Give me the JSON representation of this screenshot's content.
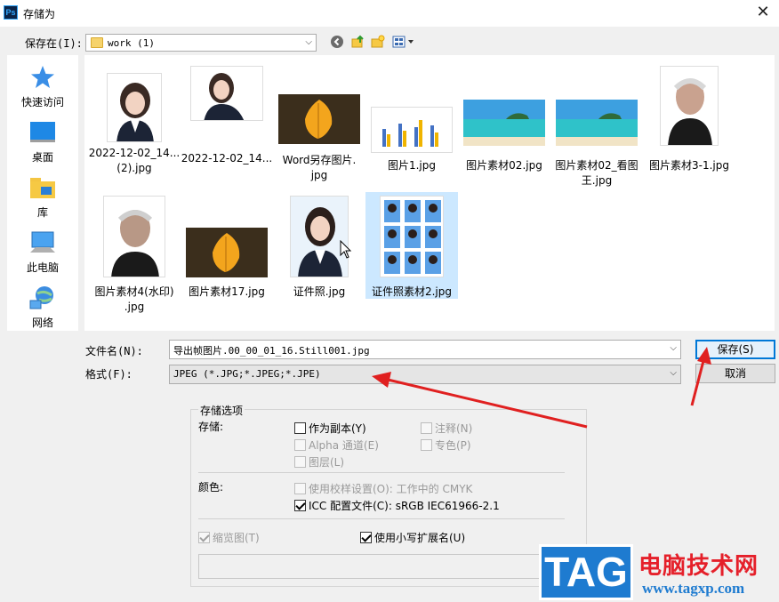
{
  "window": {
    "title": "存储为",
    "app_icon_text": "Ps"
  },
  "save_in": {
    "label": "保存在(I):",
    "folder": "work (1)"
  },
  "sidebar": {
    "items": [
      {
        "label": "快速访问",
        "icon": "star-icon"
      },
      {
        "label": "桌面",
        "icon": "desktop-icon"
      },
      {
        "label": "库",
        "icon": "library-icon"
      },
      {
        "label": "此电脑",
        "icon": "computer-icon"
      },
      {
        "label": "网络",
        "icon": "network-icon"
      }
    ]
  },
  "files": [
    {
      "name": "2022-12-02_14...(2).jpg",
      "line1": "2022-12-02_14...",
      "line2": "(2).jpg"
    },
    {
      "name": "2022-12-02_14...",
      "line1": "2022-12-02_14...",
      "line2": ""
    },
    {
      "name": "Word另存图片.jpg",
      "line1": "Word另存图片.",
      "line2": "jpg"
    },
    {
      "name": "图片1.jpg",
      "line1": "图片1.jpg",
      "line2": ""
    },
    {
      "name": "图片素材02.jpg",
      "line1": "图片素材02.jpg",
      "line2": ""
    },
    {
      "name": "图片素材02_看图王.jpg",
      "line1": "图片素材02_看图",
      "line2": "王.jpg"
    },
    {
      "name": "图片素材3-1.jpg",
      "line1": "图片素材3-1.jpg",
      "line2": ""
    },
    {
      "name": "图片素材4(水印).jpg",
      "line1": "图片素材4(水印)",
      "line2": ".jpg"
    },
    {
      "name": "图片素材17.jpg",
      "line1": "图片素材17.jpg",
      "line2": ""
    },
    {
      "name": "证件照.jpg",
      "line1": "证件照.jpg",
      "line2": ""
    },
    {
      "name": "证件照素材2.jpg",
      "line1": "证件照素材2.jpg",
      "line2": ""
    }
  ],
  "filename": {
    "label": "文件名(N):",
    "value": "导出帧图片.00_00_01_16.Still001.jpg"
  },
  "format": {
    "label": "格式(F):",
    "value": "JPEG (*.JPG;*.JPEG;*.JPE)"
  },
  "buttons": {
    "save": "保存(S)",
    "cancel": "取消"
  },
  "options": {
    "title": "存储选项",
    "storage_label": "存储:",
    "as_copy": "作为副本(Y)",
    "annotations": "注释(N)",
    "alpha": "Alpha 通道(E)",
    "spot": "专色(P)",
    "layers": "图层(L)",
    "color_label": "颜色:",
    "proof": "使用校样设置(O): 工作中的 CMYK",
    "icc": "ICC 配置文件(C): sRGB IEC61966-2.1",
    "thumbnail": "缩览图(T)",
    "lowercase": "使用小写扩展名(U)"
  },
  "watermark": {
    "tag": "TAG",
    "site_name": "电脑技术网",
    "url": "www.tagxp.com"
  },
  "colors": {
    "accent": "#0078d7",
    "annotation_arrow": "#e02020",
    "watermark_blue": "#1e7bd0"
  }
}
